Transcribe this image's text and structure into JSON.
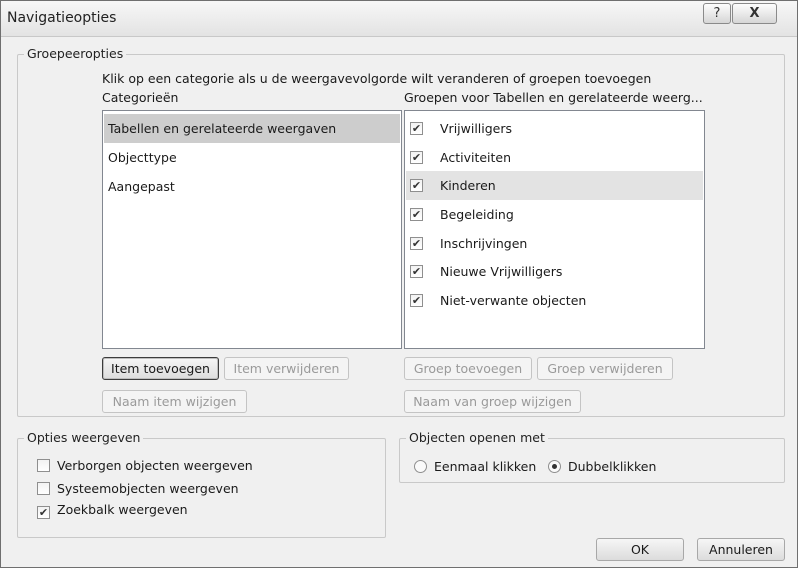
{
  "window": {
    "title": "Navigatieopties",
    "help_glyph": "?",
    "close_glyph": "X"
  },
  "groepeeropties": {
    "legend": "Groepeeropties",
    "instruction": "Klik op een categorie als u de weergavevolgorde wilt veranderen of groepen toevoegen",
    "categories_header": "Categorieën",
    "groups_header": "Groepen voor Tabellen en gerelateerde weerg...",
    "categories": [
      {
        "label": "Tabellen en gerelateerde weergaven",
        "selected": true
      },
      {
        "label": "Objecttype",
        "selected": false
      },
      {
        "label": "Aangepast",
        "selected": false
      }
    ],
    "groups": [
      {
        "label": "Vrijwilligers",
        "checked": true,
        "selected": false
      },
      {
        "label": "Activiteiten",
        "checked": true,
        "selected": false
      },
      {
        "label": "Kinderen",
        "checked": true,
        "selected": true
      },
      {
        "label": "Begeleiding",
        "checked": true,
        "selected": false
      },
      {
        "label": "Inschrijvingen",
        "checked": true,
        "selected": false
      },
      {
        "label": "Nieuwe Vrijwilligers",
        "checked": true,
        "selected": false
      },
      {
        "label": "Niet-verwante objecten",
        "checked": true,
        "selected": false
      }
    ],
    "buttons": {
      "item_add": "Item toevoegen",
      "item_remove": "Item verwijderen",
      "item_rename": "Naam item wijzigen",
      "group_add": "Groep toevoegen",
      "group_remove": "Groep verwijderen",
      "group_rename": "Naam van groep wijzigen"
    }
  },
  "opties_weergeven": {
    "legend": "Opties weergeven",
    "options": [
      {
        "label": "Verborgen objecten weergeven",
        "checked": false
      },
      {
        "label": "Systeemobjecten weergeven",
        "checked": false
      },
      {
        "label": "Zoekbalk weergeven",
        "checked": true
      }
    ]
  },
  "objecten_openen": {
    "legend": "Objecten openen met",
    "options": [
      {
        "label": "Eenmaal klikken",
        "selected": false
      },
      {
        "label": "Dubbelklikken",
        "selected": true
      }
    ]
  },
  "footer": {
    "ok": "OK",
    "cancel": "Annuleren"
  },
  "icons": {
    "checkmark": "✔"
  }
}
